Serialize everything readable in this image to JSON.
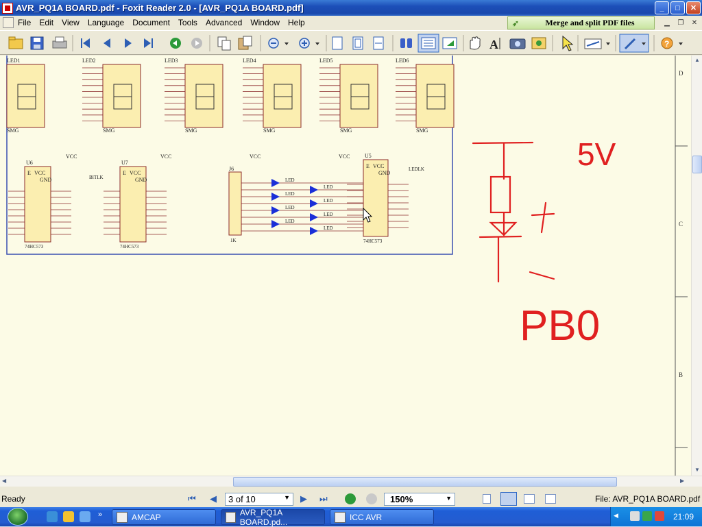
{
  "window": {
    "title": "AVR_PQ1A BOARD.pdf - Foxit Reader 2.0 - [AVR_PQ1A BOARD.pdf]",
    "minimize": "_",
    "maximize": "□",
    "close": "✕"
  },
  "menu": {
    "items": [
      "File",
      "Edit",
      "View",
      "Language",
      "Document",
      "Tools",
      "Advanced",
      "Window",
      "Help"
    ],
    "ad_text": "Merge and split PDF files"
  },
  "toolbar": {
    "icons": [
      "open-icon",
      "save-icon",
      "print-icon",
      "first-page-icon",
      "prev-page-icon",
      "next-page-icon",
      "last-page-icon",
      "back-icon",
      "forward-icon",
      "copy-icon",
      "paste-icon",
      "zoom-out-icon",
      "zoom-in-icon",
      "actual-size-icon",
      "fit-page-icon",
      "fit-width-icon",
      "find-icon",
      "continuous-icon",
      "bookmark-icon",
      "hand-tool-icon",
      "text-select-icon",
      "snapshot-icon",
      "image-tool-icon",
      "select-arrow-icon",
      "typewriter-icon",
      "pencil-tool-icon",
      "help-icon"
    ]
  },
  "schematic": {
    "led_labels": [
      "LED1",
      "LED2",
      "LED3",
      "LED4",
      "LED5",
      "LED6"
    ],
    "smg_label": "SMG",
    "chip_u6": "U6",
    "chip_u7": "U7",
    "chip_u5": "U5",
    "chip_j6": "J6",
    "chip_part": "74HC573",
    "vcc": "VCC",
    "gnd": "GND",
    "bitlk": "BITLK",
    "ledlk": "LEDLK",
    "led": "LED",
    "res": "1K",
    "border_labels": [
      "D",
      "C",
      "B"
    ]
  },
  "annotations": {
    "voltage": "5V",
    "plus": "+",
    "minus": "—",
    "pin": "PB0"
  },
  "status": {
    "ready": "Ready",
    "page": "3 of 10",
    "zoom": "150%",
    "file": "File: AVR_PQ1A BOARD.pdf"
  },
  "taskbar": {
    "tasks": [
      "AMCAP",
      "AVR_PQ1A BOARD.pd...",
      "ICC AVR"
    ],
    "clock": "21:09"
  },
  "colors": {
    "ink": "#e02020",
    "schematic_line": "#8b2b2b",
    "chip_fill": "#fbeeb0",
    "led_blue": "#1a2fd8"
  }
}
